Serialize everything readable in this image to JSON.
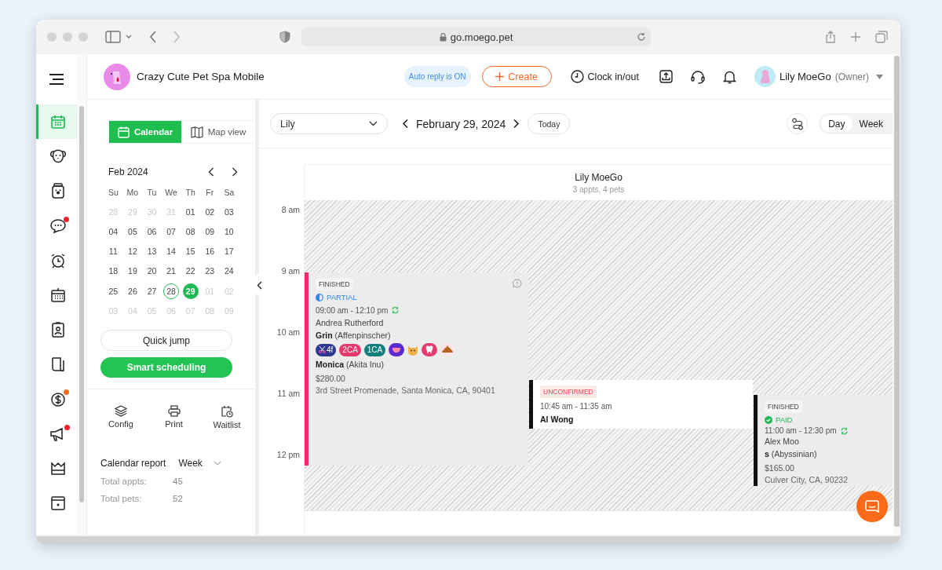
{
  "browser": {
    "url": "go.moego.pet"
  },
  "nav_rail": {
    "items": [
      {
        "kind": "calendar",
        "selected": true
      },
      {
        "kind": "dog",
        "selected": false
      },
      {
        "kind": "jar",
        "selected": false
      },
      {
        "kind": "chat",
        "selected": false,
        "color": "#f5222d"
      },
      {
        "kind": "alarm",
        "selected": false
      },
      {
        "kind": "schedule",
        "selected": false
      },
      {
        "kind": "badge",
        "selected": false
      },
      {
        "kind": "note",
        "selected": false
      },
      {
        "kind": "dollar",
        "selected": false,
        "color": "#f96b18"
      },
      {
        "kind": "megaphone",
        "selected": false,
        "color": "#f5222d"
      },
      {
        "kind": "crown",
        "selected": false
      },
      {
        "kind": "machine",
        "selected": false
      }
    ]
  },
  "header": {
    "business_name": "Crazy Cute Pet Spa Mobile",
    "auto_reply": "Auto reply is ON",
    "create": "Create",
    "clock": "Clock in/out",
    "user": {
      "name": "Lily MoeGo",
      "role": "(Owner)"
    }
  },
  "sidebar": {
    "view_tabs": [
      {
        "label": "Calendar",
        "kind": "calendar",
        "selected": true
      },
      {
        "label": "Map view",
        "kind": "map",
        "selected": false
      }
    ],
    "mini_calendar": {
      "month": "Feb 2024",
      "weekdays": [
        "Su",
        "Mo",
        "Tu",
        "We",
        "Th",
        "Fr",
        "Sa"
      ],
      "weeks": [
        [
          {
            "day": "28",
            "muted": true,
            "today": false,
            "selected": false
          },
          {
            "day": "29",
            "muted": true,
            "today": false,
            "selected": false
          },
          {
            "day": "30",
            "muted": true,
            "today": false,
            "selected": false
          },
          {
            "day": "31",
            "muted": true,
            "today": false,
            "selected": false
          },
          {
            "day": "01",
            "muted": false,
            "today": false,
            "selected": false
          },
          {
            "day": "02",
            "muted": false,
            "today": false,
            "selected": false
          },
          {
            "day": "03",
            "muted": false,
            "today": false,
            "selected": false
          }
        ],
        [
          {
            "day": "04",
            "muted": false,
            "today": false,
            "selected": false
          },
          {
            "day": "05",
            "muted": false,
            "today": false,
            "selected": false
          },
          {
            "day": "06",
            "muted": false,
            "today": false,
            "selected": false
          },
          {
            "day": "07",
            "muted": false,
            "today": false,
            "selected": false
          },
          {
            "day": "08",
            "muted": false,
            "today": false,
            "selected": false
          },
          {
            "day": "09",
            "muted": false,
            "today": false,
            "selected": false
          },
          {
            "day": "10",
            "muted": false,
            "today": false,
            "selected": false
          }
        ],
        [
          {
            "day": "11",
            "muted": false,
            "today": false,
            "selected": false
          },
          {
            "day": "12",
            "muted": false,
            "today": false,
            "selected": false
          },
          {
            "day": "13",
            "muted": false,
            "today": false,
            "selected": false
          },
          {
            "day": "14",
            "muted": false,
            "today": false,
            "selected": false
          },
          {
            "day": "15",
            "muted": false,
            "today": false,
            "selected": false
          },
          {
            "day": "16",
            "muted": false,
            "today": false,
            "selected": false
          },
          {
            "day": "17",
            "muted": false,
            "today": false,
            "selected": false
          }
        ],
        [
          {
            "day": "18",
            "muted": false,
            "today": false,
            "selected": false
          },
          {
            "day": "19",
            "muted": false,
            "today": false,
            "selected": false
          },
          {
            "day": "20",
            "muted": false,
            "today": false,
            "selected": false
          },
          {
            "day": "21",
            "muted": false,
            "today": false,
            "selected": false
          },
          {
            "day": "22",
            "muted": false,
            "today": false,
            "selected": false
          },
          {
            "day": "23",
            "muted": false,
            "today": false,
            "selected": false
          },
          {
            "day": "24",
            "muted": false,
            "today": false,
            "selected": false
          }
        ],
        [
          {
            "day": "25",
            "muted": false,
            "today": false,
            "selected": false
          },
          {
            "day": "26",
            "muted": false,
            "today": false,
            "selected": false
          },
          {
            "day": "27",
            "muted": false,
            "today": false,
            "selected": false
          },
          {
            "day": "28",
            "muted": false,
            "today": true,
            "selected": false
          },
          {
            "day": "29",
            "muted": false,
            "today": false,
            "selected": true
          },
          {
            "day": "01",
            "muted": true,
            "today": false,
            "selected": false
          },
          {
            "day": "02",
            "muted": true,
            "today": false,
            "selected": false
          }
        ],
        [
          {
            "day": "03",
            "muted": true,
            "today": false,
            "selected": false
          },
          {
            "day": "04",
            "muted": true,
            "today": false,
            "selected": false
          },
          {
            "day": "05",
            "muted": true,
            "today": false,
            "selected": false
          },
          {
            "day": "06",
            "muted": true,
            "today": false,
            "selected": false
          },
          {
            "day": "07",
            "muted": true,
            "today": false,
            "selected": false
          },
          {
            "day": "08",
            "muted": true,
            "today": false,
            "selected": false
          },
          {
            "day": "09",
            "muted": true,
            "today": false,
            "selected": false
          }
        ]
      ]
    },
    "quick_jump": "Quick jump",
    "smart_scheduling": "Smart scheduling",
    "tools": [
      {
        "kind": "layers",
        "label": "Config"
      },
      {
        "kind": "print",
        "label": "Print"
      },
      {
        "kind": "waitlist",
        "label": "Waitlist"
      }
    ],
    "report": {
      "title": "Calendar report",
      "period": "Week",
      "stats": [
        {
          "label": "Total appts:",
          "value": "45"
        },
        {
          "label": "Total pets:",
          "value": "52"
        }
      ]
    }
  },
  "toolbar": {
    "staff": "Lily",
    "date": "February 29, 2024",
    "today": "Today",
    "view_modes": [
      {
        "label": "Day",
        "selected": true
      },
      {
        "label": "Week",
        "selected": false
      }
    ]
  },
  "calendar": {
    "staff": {
      "name": "Lily MoeGo",
      "summary": "3 appts, 4 pets"
    },
    "hours": [
      "8 am",
      "9 am",
      "10 am",
      "11 am",
      "12 pm"
    ],
    "appointments": [
      {
        "status": "FINISHED",
        "confirmed": true,
        "payment": {
          "label": "PARTIAL",
          "kind": "partial"
        },
        "time": "09:00 am - 12:10 pm",
        "repeat": true,
        "info": true,
        "client": "Andrea Rutherford",
        "color": "#ef2b6f",
        "pets": [
          {
            "name": "Grin",
            "breed": "(Affenpinscher)",
            "tags": [
              {
                "kind": "groom",
                "label": "4f",
                "color": "#2b3a8f"
              },
              {
                "kind": "text",
                "label": "2CA",
                "color": "#e63a6e"
              },
              {
                "kind": "text",
                "label": "1CA",
                "color": "#11807c"
              },
              {
                "kind": "mouth",
                "color": "#5a2bd3"
              },
              {
                "kind": "cat",
                "color": "#f3b24a"
              },
              {
                "kind": "tooth",
                "color": "#e63a6e"
              },
              {
                "kind": "poop",
                "color": "#b5651d"
              }
            ]
          },
          {
            "name": "Monica",
            "breed": "(Akita Inu)"
          }
        ],
        "price": "$280.00",
        "address": "3rd Street Promenade, Santa Monica, CA, 90401"
      },
      {
        "status": "UNCONFIRMED",
        "confirmed": false,
        "time": "10:45 am - 11:35 am",
        "repeat": false,
        "info": false,
        "client": "Al Wong",
        "color": "#111111"
      },
      {
        "status": "FINISHED",
        "confirmed": true,
        "payment": {
          "label": "PAID",
          "kind": "paid"
        },
        "time": "11:00 am - 12:30 pm",
        "repeat": true,
        "info": false,
        "client": "Alex Moo",
        "color": "#111111",
        "pets": [
          {
            "name": "s",
            "breed": "(Abyssinian)"
          }
        ],
        "price": "$165.00",
        "address": "Culver City, CA, 90232"
      }
    ]
  }
}
